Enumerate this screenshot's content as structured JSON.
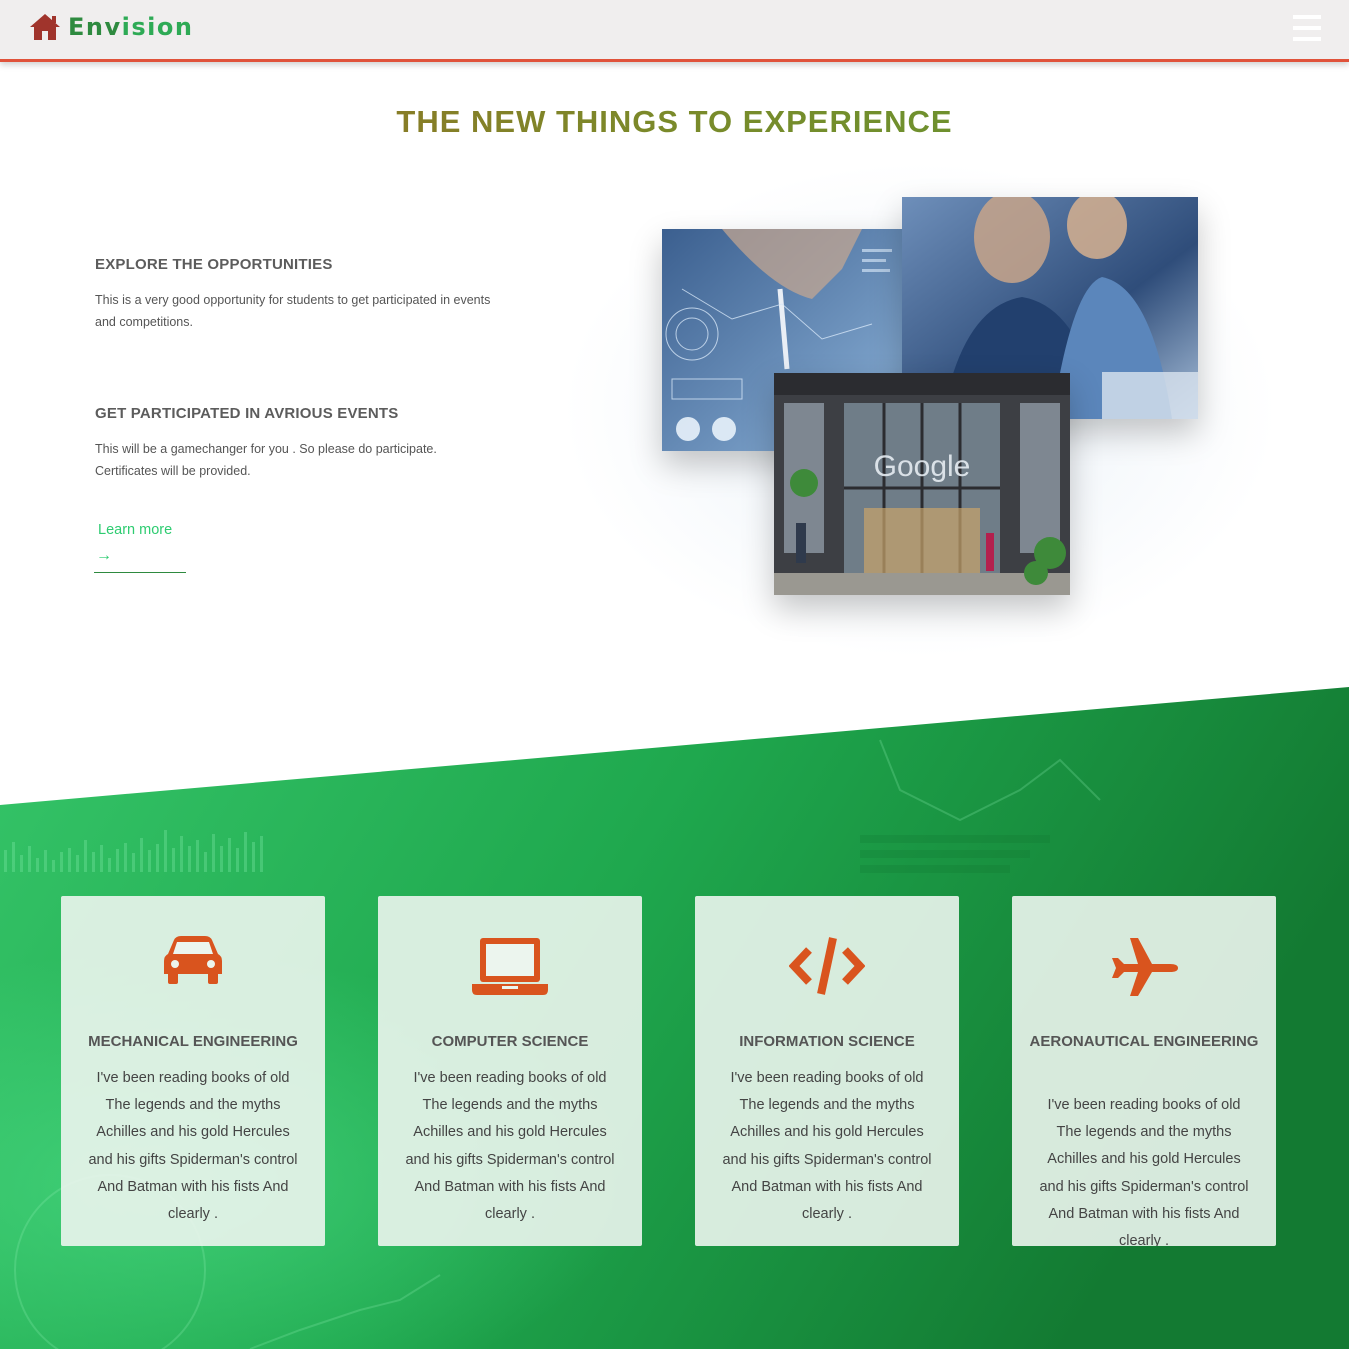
{
  "nav": {
    "brand_part1": "Env",
    "brand_part2": "ision",
    "menu_icon": "hamburger-menu-icon",
    "home_icon": "home-icon"
  },
  "main": {
    "title": "THE NEW THINGS TO EXPERIENCE",
    "features": [
      {
        "heading": "EXPLORE THE OPPORTUNITIES",
        "text": "This is a very good opportunity for students to get participated in events and competitions."
      },
      {
        "heading": "GET PARTICIPATED IN AVRIOUS EVENTS",
        "text": "This will be a gamechanger for you . So please do participate. Certificates will be provided."
      }
    ],
    "learn_more": "Learn more",
    "learn_arrow": "→",
    "photo_sign": "Google"
  },
  "cards": [
    {
      "icon": "car-icon",
      "title": "MECHANICAL ENGINEERING",
      "text": "I've been reading books of old The legends and the myths Achilles and his gold Hercules and his gifts Spiderman's control And Batman with his fists And clearly ."
    },
    {
      "icon": "laptop-icon",
      "title": "COMPUTER SCIENCE",
      "text": "I've been reading books of old The legends and the myths Achilles and his gold Hercules and his gifts Spiderman's control And Batman with his fists And clearly ."
    },
    {
      "icon": "code-icon",
      "title": "INFORMATION SCIENCE",
      "text": "I've been reading books of old The legends and the myths Achilles and his gold Hercules and his gifts Spiderman's control And Batman with his fists And clearly ."
    },
    {
      "icon": "airplane-icon",
      "title": "AERONAUTICAL ENGINEERING",
      "text": "I've been reading books of old The legends and the myths Achilles and his gold Hercules and his gifts Spiderman's control And Batman with his fists And clearly ."
    }
  ],
  "colors": {
    "accent_green": "#2ecc71",
    "icon_orange": "#d9541e",
    "nav_border": "#e0523a"
  }
}
